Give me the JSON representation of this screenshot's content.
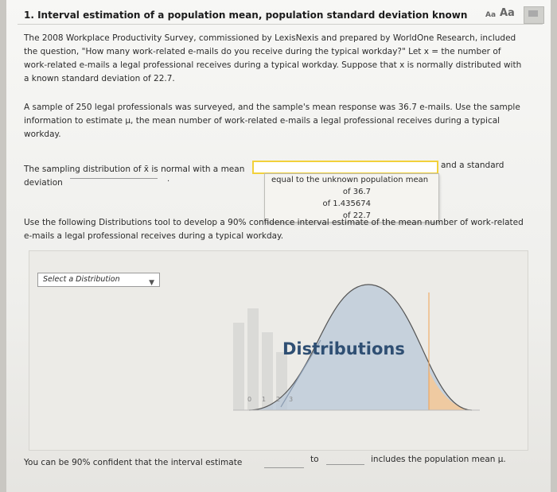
{
  "question": {
    "title": "1. Interval estimation of a population mean, population standard deviation known",
    "font_small": "Aa",
    "font_large": "Aa"
  },
  "paragraph1": "The 2008 Workplace Productivity Survey, commissioned by LexisNexis and prepared by WorldOne Research, included the question, \"How many work-related e-mails do you receive during the typical workday?\" Let x = the number of work-related e-mails a legal professional receives during a typical workday. Suppose that x is normally distributed with a known standard deviation of 22.7.",
  "paragraph2": "A sample of 250 legal professionals was surveyed, and the sample's mean response was 36.7 e-mails. Use the sample information to estimate μ, the mean number of work-related e-mails a legal professional receives during a typical workday.",
  "sampling": {
    "label": "The sampling distribution of x̄ is normal with a mean",
    "deviation": "deviation",
    "period": ".",
    "after": "and a standard",
    "dropdown_options": [
      "equal to the unknown population mean",
      "of 36.7",
      "of 1.435674",
      "of 22.7"
    ]
  },
  "paragraph3": "Use the following Distributions tool to develop a 90% confidence interval estimate of the mean number of work-related e-mails a legal professional receives during a typical workday.",
  "tool": {
    "select_label": "Select a Distribution",
    "overlay_title": "Distributions",
    "axis_ticks": [
      "0",
      "1",
      "2",
      "3"
    ]
  },
  "final": {
    "text1": "You can be 90% confident that the interval estimate",
    "to": "to",
    "text2": "includes the population mean μ."
  },
  "colors": {
    "dropdown_border": "#f2d13b",
    "curve_fill": "#b9c8d8",
    "tail_fill": "#f3c99a",
    "title_color": "#2f4f73"
  }
}
